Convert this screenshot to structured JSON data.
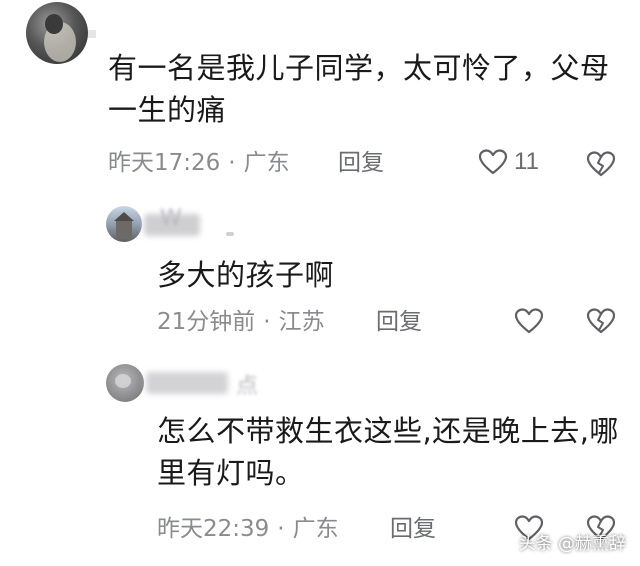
{
  "comments": [
    {
      "text": "有一名是我儿子同学，太可怜了，父母一生的痛",
      "time": "昨天17:26",
      "location": "广东",
      "reply_label": "回复",
      "like_count": "11"
    },
    {
      "username_partial": "W",
      "text": "多大的孩子啊",
      "time": "21分钟前",
      "location": "江苏",
      "reply_label": "回复"
    },
    {
      "username_partial": "点",
      "text": "怎么不带救生衣这些,还是晚上去,哪里有灯吗。",
      "time": "昨天22:39",
      "location": "广东",
      "reply_label": "回复"
    }
  ],
  "separator": "·",
  "watermark": "头条 @赫熏辞",
  "icons": {
    "like": "heart-outline-icon",
    "dislike": "broken-heart-icon"
  },
  "colors": {
    "text": "#1a1a1a",
    "meta": "#8a8b91",
    "icon": "#5f6066"
  }
}
